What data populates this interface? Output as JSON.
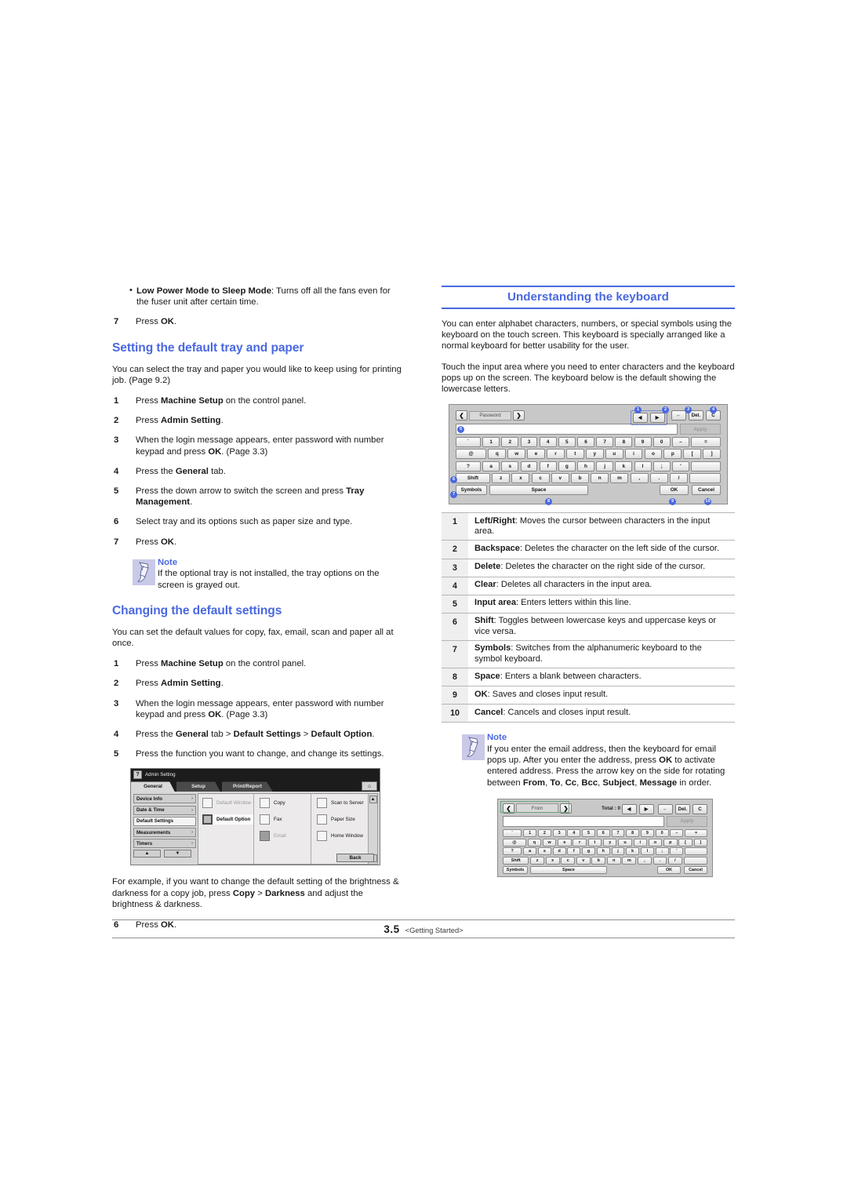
{
  "colors": {
    "heading_blue": "#4a68e0",
    "callout_blue": "#4a68e0",
    "note_icon_bg": "#c9c9e8",
    "highlight_green": "#6aa47f"
  },
  "left_column": {
    "bullet": {
      "term": "Low Power Mode to Sleep Mode",
      "text": ": Turns off all the fans even for the fuser unit after certain time."
    },
    "step_ok_top": {
      "num": "7",
      "text_pre": "Press ",
      "bold": "OK",
      "text_post": "."
    },
    "section1": {
      "heading": "Setting the default tray and paper",
      "intro": "You can select the tray and paper you would like to keep using for printing job. (Page 9.2)",
      "steps": [
        {
          "num": "1",
          "parts": [
            {
              "t": "Press "
            },
            {
              "t": "Machine Setup",
              "b": true
            },
            {
              "t": " on the control panel."
            }
          ]
        },
        {
          "num": "2",
          "parts": [
            {
              "t": "Press "
            },
            {
              "t": "Admin Setting",
              "b": true
            },
            {
              "t": "."
            }
          ]
        },
        {
          "num": "3",
          "parts": [
            {
              "t": "When the login message appears, enter password with number keypad and press "
            },
            {
              "t": "OK",
              "b": true
            },
            {
              "t": ". (Page 3.3)"
            }
          ]
        },
        {
          "num": "4",
          "parts": [
            {
              "t": "Press the "
            },
            {
              "t": "General",
              "b": true
            },
            {
              "t": " tab."
            }
          ]
        },
        {
          "num": "5",
          "parts": [
            {
              "t": "Press the down arrow to switch the screen and press "
            },
            {
              "t": "Tray Management",
              "b": true
            },
            {
              "t": "."
            }
          ]
        },
        {
          "num": "6",
          "parts": [
            {
              "t": "Select tray and its options such as paper size and type."
            }
          ]
        },
        {
          "num": "7",
          "parts": [
            {
              "t": "Press "
            },
            {
              "t": "OK",
              "b": true
            },
            {
              "t": "."
            }
          ]
        }
      ],
      "note": {
        "title": "Note",
        "body": "If the optional tray is not installed, the tray options on the screen is grayed out."
      }
    },
    "section2": {
      "heading": "Changing the default settings",
      "intro": "You can set the default values for copy, fax, email, scan and paper all at once.",
      "steps": [
        {
          "num": "1",
          "parts": [
            {
              "t": "Press "
            },
            {
              "t": "Machine Setup",
              "b": true
            },
            {
              "t": " on the control panel."
            }
          ]
        },
        {
          "num": "2",
          "parts": [
            {
              "t": "Press "
            },
            {
              "t": "Admin Setting",
              "b": true
            },
            {
              "t": "."
            }
          ]
        },
        {
          "num": "3",
          "parts": [
            {
              "t": "When the login message appears, enter password with number keypad and press "
            },
            {
              "t": "OK",
              "b": true
            },
            {
              "t": ". (Page 3.3)"
            }
          ]
        },
        {
          "num": "4",
          "parts": [
            {
              "t": "Press the "
            },
            {
              "t": "General",
              "b": true
            },
            {
              "t": " tab > "
            },
            {
              "t": "Default Settings",
              "b": true
            },
            {
              "t": " > "
            },
            {
              "t": "Default Option",
              "b": true
            },
            {
              "t": "."
            }
          ]
        },
        {
          "num": "5",
          "parts": [
            {
              "t": "Press the function you want to change, and change its settings."
            }
          ]
        }
      ],
      "example": {
        "parts": [
          {
            "t": "For example, if you want to change the default setting of the brightness & darkness for a copy job, press "
          },
          {
            "t": "Copy",
            "b": true
          },
          {
            "t": " > "
          },
          {
            "t": "Darkness",
            "b": true
          },
          {
            "t": " and adjust the brightness & darkness."
          }
        ]
      },
      "step_final": {
        "num": "6",
        "parts": [
          {
            "t": "Press "
          },
          {
            "t": "OK",
            "b": true
          },
          {
            "t": "."
          }
        ]
      }
    },
    "admin_screenshot": {
      "window_title": "Admin Setting",
      "help_icon": "question-mark-icon",
      "home_icon": "home-icon",
      "tabs": [
        {
          "label": "General",
          "active": true
        },
        {
          "label": "Setup",
          "active": false
        },
        {
          "label": "Print/Report",
          "active": false
        }
      ],
      "sidebar": [
        {
          "label": "Device Info",
          "arrow": "›",
          "selected": false
        },
        {
          "label": "Date & Time",
          "arrow": "›",
          "selected": false
        },
        {
          "label": "Default Settings",
          "arrow": "",
          "selected": true
        },
        {
          "label": "Measurements",
          "arrow": "›",
          "selected": false
        },
        {
          "label": "Timers",
          "arrow": "›",
          "selected": false
        }
      ],
      "nav_up": "▲",
      "nav_down": "▼",
      "options_col1": [
        {
          "label": "Default Window",
          "state": "unchecked"
        },
        {
          "label": "Default Option",
          "state": "selected"
        }
      ],
      "options_col2": [
        {
          "label": "Copy",
          "state": "unchecked"
        },
        {
          "label": "Fax",
          "state": "unchecked"
        },
        {
          "label": "Email",
          "state": "disabled"
        }
      ],
      "options_col3": [
        {
          "label": "Scan to Server",
          "state": "unchecked"
        },
        {
          "label": "Paper Size",
          "state": "unchecked"
        },
        {
          "label": "Home Window",
          "state": "unchecked"
        }
      ],
      "scroll_up": "▲",
      "scroll_down": "▼",
      "back_button": "Back"
    }
  },
  "right_column": {
    "heading": "Understanding the keyboard",
    "paragraphs": [
      "You can enter alphabet characters, numbers, or special symbols using the keyboard on the touch screen. This keyboard is specially arranged like a normal keyboard for better usability for the user.",
      "Touch the input area where you need to enter characters and the keyboard pops up on the screen. The keyboard below is the default showing the lowercase letters."
    ],
    "keyboard_main": {
      "field_label": "Password",
      "prev_arrow": "❮",
      "next_arrow": "❯",
      "cursor_left": "◀",
      "cursor_right": "▶",
      "backspace": "←",
      "delete_label": "Del.",
      "clear_label": "C",
      "input_value": "",
      "apply_label": "Apply",
      "rows": [
        [
          "`",
          "1",
          "2",
          "3",
          "4",
          "5",
          "6",
          "7",
          "8",
          "9",
          "0",
          "–",
          "="
        ],
        [
          "@",
          "q",
          "w",
          "e",
          "r",
          "t",
          "y",
          "u",
          "i",
          "o",
          "p",
          "[",
          "]"
        ],
        [
          "?",
          "a",
          "s",
          "d",
          "f",
          "g",
          "h",
          "j",
          "k",
          "l",
          ";",
          "'",
          ""
        ],
        [
          "Shift",
          "z",
          "x",
          "c",
          "v",
          "b",
          "n",
          "m",
          ",",
          ".",
          "/",
          ""
        ]
      ],
      "symbols_label": "Symbols",
      "space_label": "Space",
      "ok_label": "OK",
      "cancel_label": "Cancel",
      "callouts": [
        "1",
        "2",
        "3",
        "4",
        "5",
        "6",
        "7",
        "8",
        "9",
        "10"
      ]
    },
    "legend": [
      {
        "n": "1",
        "term": "Left/Right",
        "desc": ": Moves the cursor between characters in the input area."
      },
      {
        "n": "2",
        "term": "Backspace",
        "desc": ": Deletes the character on the left side of the cursor."
      },
      {
        "n": "3",
        "term": "Delete",
        "desc": ": Deletes the character on the right side of the cursor."
      },
      {
        "n": "4",
        "term": "Clear",
        "desc": ": Deletes all characters in the input area."
      },
      {
        "n": "5",
        "term": "Input area",
        "desc": ": Enters letters within this line."
      },
      {
        "n": "6",
        "term": "Shift",
        "desc": ": Toggles between lowercase keys and uppercase keys or vice versa."
      },
      {
        "n": "7",
        "term": "Symbols",
        "desc": ": Switches from the alphanumeric keyboard to the symbol keyboard."
      },
      {
        "n": "8",
        "term": "Space",
        "desc": ": Enters a blank between characters."
      },
      {
        "n": "9",
        "term": "OK",
        "desc": ": Saves and closes input result."
      },
      {
        "n": "10",
        "term": "Cancel",
        "desc": ": Cancels and closes input result."
      }
    ],
    "note": {
      "title": "Note",
      "parts": [
        {
          "t": "If you enter the email address, then the keyboard for email pops up. After you enter the address, press "
        },
        {
          "t": "OK",
          "b": true
        },
        {
          "t": " to activate entered address. Press the arrow key on the side for rotating between "
        },
        {
          "t": "From",
          "b": true
        },
        {
          "t": ", "
        },
        {
          "t": "To",
          "b": true
        },
        {
          "t": ", "
        },
        {
          "t": "Cc",
          "b": true
        },
        {
          "t": ", "
        },
        {
          "t": "Bcc",
          "b": true
        },
        {
          "t": ", "
        },
        {
          "t": "Subject",
          "b": true
        },
        {
          "t": ", "
        },
        {
          "t": "Message",
          "b": true
        },
        {
          "t": " in order."
        }
      ]
    },
    "keyboard_email": {
      "field_label": "From",
      "prev_arrow": "❮",
      "next_arrow": "❯",
      "total_label": "Total : 0",
      "cursor_left": "◀",
      "cursor_right": "▶",
      "backspace": "←",
      "delete_label": "Del.",
      "clear_label": "C",
      "input_value": "",
      "apply_label": "Apply",
      "rows": [
        [
          "`",
          "1",
          "2",
          "3",
          "4",
          "5",
          "6",
          "7",
          "8",
          "9",
          "0",
          "–",
          "="
        ],
        [
          "@",
          "q",
          "w",
          "e",
          "r",
          "t",
          "y",
          "u",
          "i",
          "o",
          "p",
          "[",
          "]"
        ],
        [
          "?",
          "a",
          "s",
          "d",
          "f",
          "g",
          "h",
          "j",
          "k",
          "l",
          ";",
          "'",
          ""
        ],
        [
          "Shift",
          "z",
          "x",
          "c",
          "v",
          "b",
          "n",
          "m",
          ",",
          ".",
          "/",
          ""
        ]
      ],
      "symbols_label": "Symbols",
      "space_label": "Space",
      "ok_label": "OK",
      "cancel_label": "Cancel"
    }
  },
  "footer": {
    "page_number": "3.5",
    "chapter": "<Getting Started>"
  }
}
